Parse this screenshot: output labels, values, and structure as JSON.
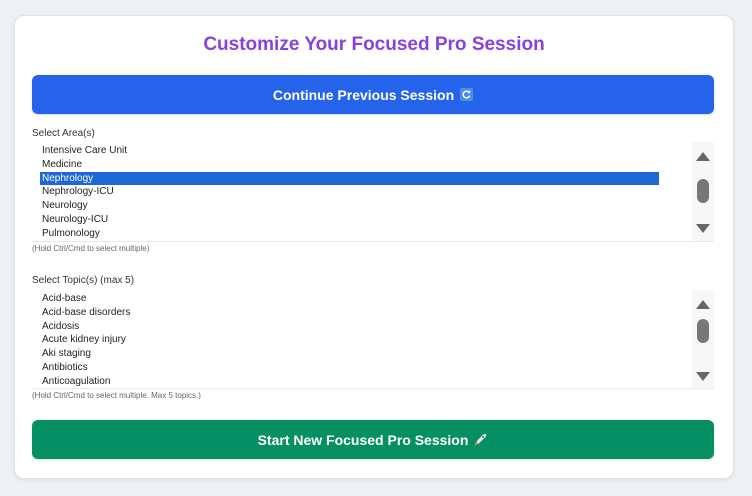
{
  "title": "Customize Your Focused Pro Session",
  "continue_button": {
    "label": "Continue Previous Session",
    "icon": "refresh-icon"
  },
  "areas": {
    "label": "Select Area(s)",
    "options": [
      "Intensive Care Unit",
      "Medicine",
      "Nephrology",
      "Nephrology-ICU",
      "Neurology",
      "Neurology-ICU",
      "Pulmonology"
    ],
    "selected": "Nephrology",
    "hint": "(Hold Ctrl/Cmd to select multiple)"
  },
  "topics": {
    "label": "Select Topic(s) (max 5)",
    "options": [
      "Acid-base",
      "Acid-base disorders",
      "Acidosis",
      "Acute kidney injury",
      "Aki staging",
      "Antibiotics",
      "Anticoagulation"
    ],
    "hint": "(Hold Ctrl/Cmd to select multiple. Max 5 topics.)"
  },
  "start_button": {
    "label": "Start New Focused Pro Session",
    "icon": "rocket-icon"
  },
  "colors": {
    "title": "#8a3fe0",
    "primary": "#2563eb",
    "success": "#068f63",
    "selection": "#1f66d6"
  }
}
